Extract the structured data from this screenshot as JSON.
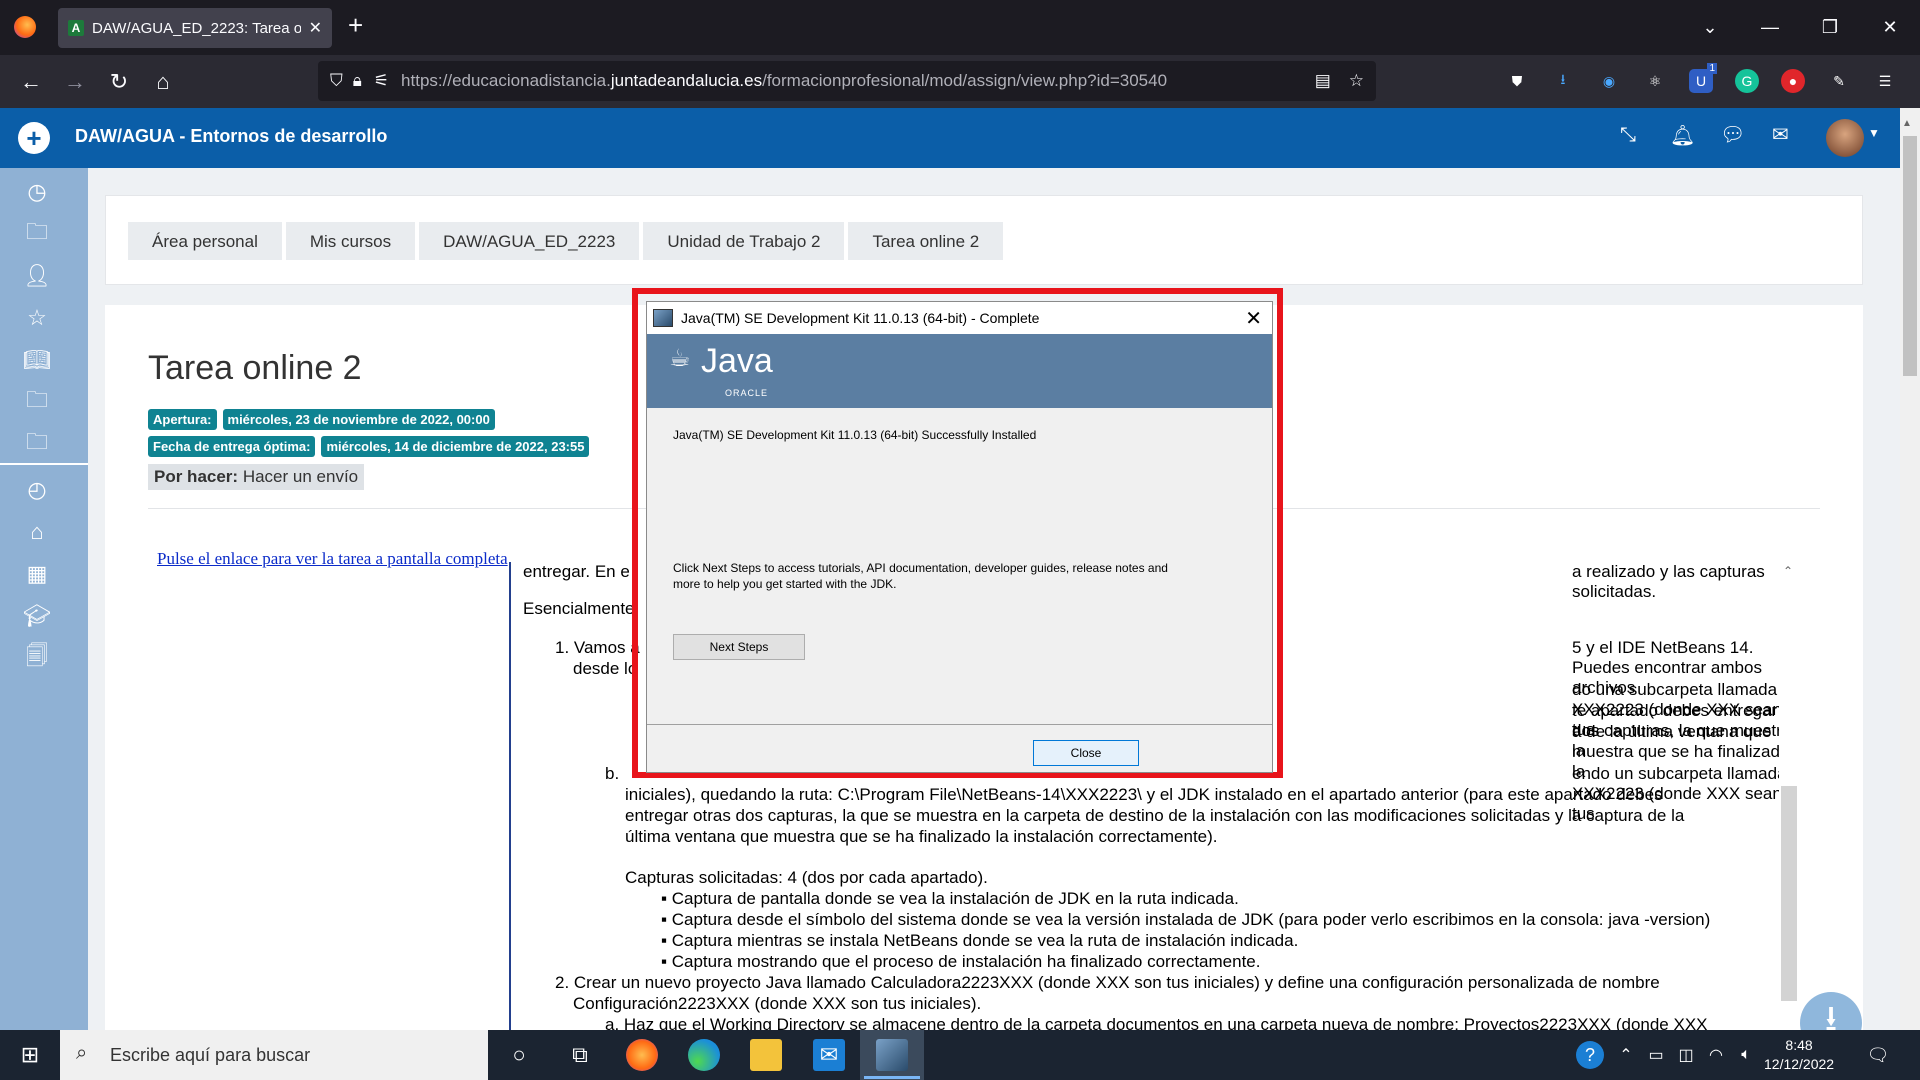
{
  "browser": {
    "tab_title": "DAW/AGUA_ED_2223: Tarea onl",
    "tab_favicon": "A",
    "new_tab": "+",
    "url_prefix": "https://educacionadistancia.",
    "url_domain": "juntadeandalucia.es",
    "url_path": "/formacionprofesional/mod/assign/view.php?id=30540",
    "extension_badge": "1"
  },
  "moodle": {
    "course_title": "DAW/AGUA - Entornos de desarrollo",
    "breadcrumb": [
      "Área personal",
      "Mis cursos",
      "DAW/AGUA_ED_2223",
      "Unidad de Trabajo 2",
      "Tarea online 2"
    ],
    "task_title": "Tarea online 2",
    "opening_label": "Apertura:",
    "opening_value": "miércoles, 23 de noviembre de 2022, 00:00",
    "due_label": "Fecha de entrega óptima:",
    "due_value": "miércoles, 14 de diciembre de 2022, 23:55",
    "status_label": "Por hacer:",
    "status_value": "Hacer un envío",
    "fullscreen_link": "Pulse el enlace para ver la tarea a pantalla completa"
  },
  "iframe_text": {
    "line_top_left": "entregar. En e",
    "line_top_right": "a realizado y las capturas solicitadas.",
    "essentially": "Esencialmente,",
    "item1_a": "1.  Vamos a",
    "item1_right": "5 y el IDE NetBeans 14. Puedes encontrar ambos archivos",
    "item1_b": "desde lo",
    "a_right1": "do una subcarpeta llamada XXX2223 (donde XXX sean tus",
    "a_right2": "te apartado debes entregar dos capturas, la que muestra la",
    "a_right3": "a de la última ventana que muestra que se ha finalizado la",
    "b_right": "endo un subcarpeta llamada XXX2223 (donde XXX sean tus",
    "b_line2": "iniciales), quedando la ruta: C:\\Program File\\NetBeans-14\\XXX2223\\ y el JDK instalado en el apartado anterior (para este apartado debes",
    "b_line3": "entregar otras dos capturas, la que se muestra en la carpeta de destino de la instalación con las modificaciones solicitadas y la captura de la",
    "b_line4": "última ventana que muestra que se ha finalizado la instalación correctamente).",
    "captures": "Capturas solicitadas: 4 (dos por cada apartado).",
    "bullets": [
      "Captura de pantalla donde se vea la instalación de JDK en la ruta indicada.",
      "Captura desde el símbolo del sistema donde se vea la versión instalada de JDK (para poder verlo escribimos en la consola: java -version)",
      "Captura mientras se instala NetBeans donde se vea la ruta de instalación indicada.",
      "Captura mostrando que el proceso de instalación ha finalizado correctamente."
    ],
    "item2_line1": "2.  Crear un nuevo proyecto Java llamado Calculadora2223XXX (donde XXX son tus iniciales) y define una configuración personalizada de nombre",
    "item2_line2": "Configuración2223XXX (donde XXX son tus iniciales).",
    "item2_a": "a.  Haz que el Working Directory se almacene dentro de la carpeta documentos en una carpeta nueva de nombre: Proyectos2223XXX (donde XXX"
  },
  "dialog": {
    "title": "Java(TM) SE Development Kit 11.0.13 (64-bit) - Complete",
    "logo_text": "Java",
    "logo_sub": "ORACLE",
    "installed_msg": "Java(TM) SE Development Kit 11.0.13 (64-bit) Successfully Installed",
    "next_steps_msg_1": "Click Next Steps to access tutorials, API documentation, developer guides, release notes and",
    "next_steps_msg_2": "more to help you get started with the JDK.",
    "next_steps_button": "Next Steps",
    "close_button": "Close",
    "highlight_color": "#e8141b"
  },
  "taskbar": {
    "search_placeholder": "Escribe aquí para buscar",
    "time": "8:48",
    "date": "12/12/2022"
  },
  "colors": {
    "moodle_blue": "#0b5ea8",
    "badge_teal": "#0f8392",
    "sidebar": "#8fb1d4"
  }
}
